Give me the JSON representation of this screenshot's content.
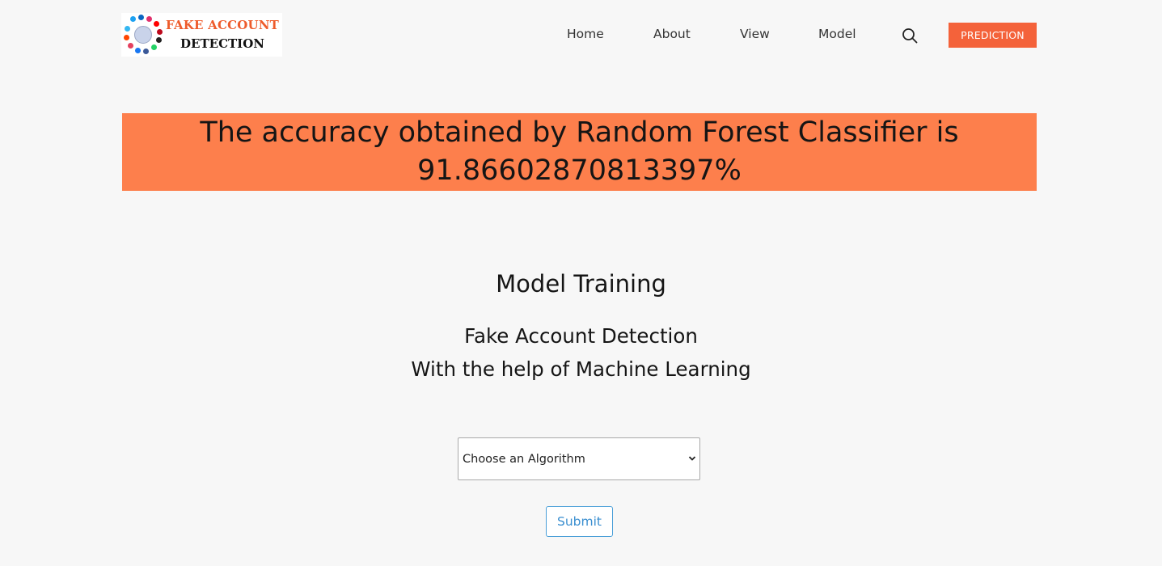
{
  "header": {
    "logo": {
      "line1": "FAKE ACCOUNT",
      "line2": "DETECTION"
    },
    "nav": [
      {
        "label": "Home"
      },
      {
        "label": "About"
      },
      {
        "label": "View"
      },
      {
        "label": "Model"
      }
    ],
    "search_icon": "search-icon",
    "prediction_label": "PREDICTION"
  },
  "banner": {
    "line1": "The accuracy obtained by Random Forest Classifier is",
    "line2": "91.86602870813397%"
  },
  "main": {
    "title": "Model Training",
    "subtitle1": "Fake Account Detection",
    "subtitle2": "With the help of Machine Learning",
    "algorithm_select": {
      "selected": "Choose an Algorithm"
    },
    "submit_label": "Submit"
  },
  "colors": {
    "accent": "#f4623a",
    "banner": "#fd7f4c",
    "background": "#f7f7f7",
    "submit_border": "#4a9fd8"
  }
}
